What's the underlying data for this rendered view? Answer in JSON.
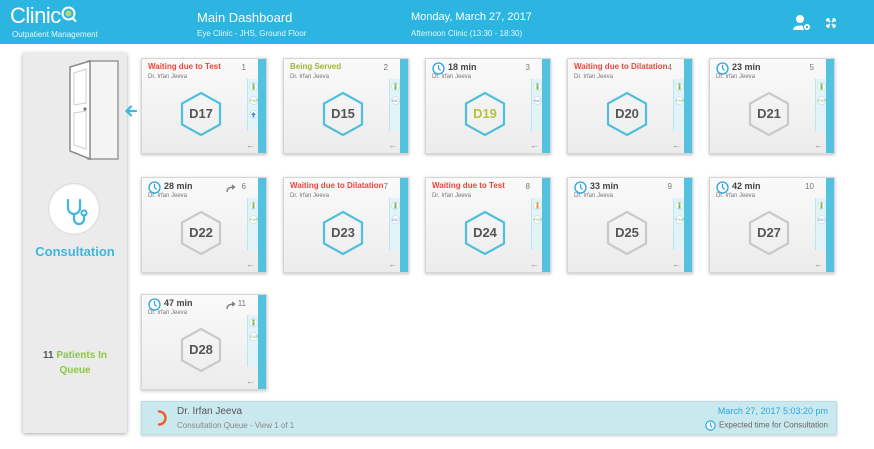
{
  "header": {
    "logo": "Clinic",
    "subtitle": "Outpatient Management",
    "title": "Main Dashboard",
    "location": "Eye Clinic - JHS, Ground Floor",
    "date": "Monday, March 27, 2017",
    "session": "Afternoon Clinic (13:30 - 18:30)",
    "icons": [
      "user-settings-icon",
      "fullscreen-icon"
    ]
  },
  "sidebar": {
    "icon": "stethoscope-icon",
    "label": "Consultation",
    "queue_count": "11",
    "queue_text": "Patients In Queue"
  },
  "cards": [
    {
      "status": "Waiting due to Test",
      "status_type": "red",
      "doctor": "Dr. Irfan Jeeva",
      "index": "1",
      "room": "D17",
      "hex_color": "#4fbfdb",
      "badges": [
        "person",
        "PUP",
        "up"
      ]
    },
    {
      "status": "Being Served",
      "status_type": "olive",
      "doctor": "Dr. Irfan Jeeva",
      "index": "2",
      "room": "D15",
      "hex_color": "#4fbfdb",
      "badges": [
        "person",
        "INC"
      ]
    },
    {
      "status": "18 min",
      "status_type": "time",
      "doctor": "Dr. Irfan Jeeva",
      "index": "3",
      "room": "D19",
      "hex_color": "#4fbfdb",
      "room_color": "#b7c23b",
      "badges": [
        "person",
        "INC"
      ]
    },
    {
      "status": "Waiting due to Dilatation",
      "status_type": "red",
      "doctor": "Dr. Irfan Jeeva",
      "index": "4",
      "room": "D20",
      "hex_color": "#4fbfdb",
      "badges": [
        "person",
        "PUP"
      ]
    },
    {
      "status": "23 min",
      "status_type": "time",
      "doctor": "Dr. Irfan Jeeva",
      "index": "5",
      "room": "D21",
      "hex_color": "#c9c9c9",
      "badges": [
        "person",
        "PUP"
      ]
    },
    {
      "status": "28 min",
      "status_type": "time",
      "doctor": "Dr. Irfan Jeeva",
      "index": "6",
      "room": "D22",
      "hex_color": "#c9c9c9",
      "badges": [
        "person",
        "PUP"
      ],
      "redirect": true
    },
    {
      "status": "Waiting due to Dilatation",
      "status_type": "red",
      "doctor": "Dr. Irfan Jeeva",
      "index": "7",
      "room": "D23",
      "hex_color": "#4fbfdb",
      "badges": [
        "person",
        "INC"
      ]
    },
    {
      "status": "Waiting due to Test",
      "status_type": "red",
      "doctor": "Dr. Irfan Jeeva",
      "index": "8",
      "room": "D24",
      "hex_color": "#4fbfdb",
      "badges": [
        "person-orange",
        "PUP"
      ]
    },
    {
      "status": "33 min",
      "status_type": "time",
      "doctor": "Dr. Irfan Jeeva",
      "index": "9",
      "room": "D25",
      "hex_color": "#c9c9c9",
      "badges": [
        "person",
        "PUP"
      ]
    },
    {
      "status": "42 min",
      "status_type": "time",
      "doctor": "Dr. Irfan Jeeva",
      "index": "10",
      "room": "D27",
      "hex_color": "#c9c9c9",
      "badges": [
        "person",
        "INC"
      ]
    },
    {
      "status": "47 min",
      "status_type": "time",
      "doctor": "Dr. Irfan Jeeva",
      "index": "11",
      "room": "D28",
      "hex_color": "#c9c9c9",
      "badges": [
        "person",
        "PUP"
      ],
      "redirect": true
    }
  ],
  "footer": {
    "doctor": "Dr. Irfan Jeeva",
    "queue_view": "Consultation Queue - View 1 of 1",
    "timestamp": "March 27, 2017 5:03:20 pm",
    "expected_label": "Expected time for Consultation"
  },
  "colors": {
    "header": "#2cb5e0",
    "accent": "#52c2df",
    "alert": "#e8463a",
    "served": "#a0b532",
    "queue_green": "#8cc63f"
  }
}
